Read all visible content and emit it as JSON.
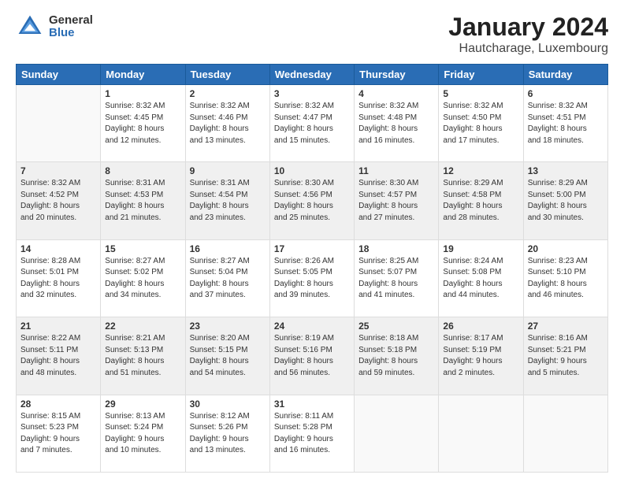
{
  "header": {
    "logo_general": "General",
    "logo_blue": "Blue",
    "title": "January 2024",
    "subtitle": "Hautcharage, Luxembourg"
  },
  "days_of_week": [
    "Sunday",
    "Monday",
    "Tuesday",
    "Wednesday",
    "Thursday",
    "Friday",
    "Saturday"
  ],
  "weeks": [
    [
      {
        "day": "",
        "info": ""
      },
      {
        "day": "1",
        "info": "Sunrise: 8:32 AM\nSunset: 4:45 PM\nDaylight: 8 hours\nand 12 minutes."
      },
      {
        "day": "2",
        "info": "Sunrise: 8:32 AM\nSunset: 4:46 PM\nDaylight: 8 hours\nand 13 minutes."
      },
      {
        "day": "3",
        "info": "Sunrise: 8:32 AM\nSunset: 4:47 PM\nDaylight: 8 hours\nand 15 minutes."
      },
      {
        "day": "4",
        "info": "Sunrise: 8:32 AM\nSunset: 4:48 PM\nDaylight: 8 hours\nand 16 minutes."
      },
      {
        "day": "5",
        "info": "Sunrise: 8:32 AM\nSunset: 4:50 PM\nDaylight: 8 hours\nand 17 minutes."
      },
      {
        "day": "6",
        "info": "Sunrise: 8:32 AM\nSunset: 4:51 PM\nDaylight: 8 hours\nand 18 minutes."
      }
    ],
    [
      {
        "day": "7",
        "info": "Sunrise: 8:32 AM\nSunset: 4:52 PM\nDaylight: 8 hours\nand 20 minutes."
      },
      {
        "day": "8",
        "info": "Sunrise: 8:31 AM\nSunset: 4:53 PM\nDaylight: 8 hours\nand 21 minutes."
      },
      {
        "day": "9",
        "info": "Sunrise: 8:31 AM\nSunset: 4:54 PM\nDaylight: 8 hours\nand 23 minutes."
      },
      {
        "day": "10",
        "info": "Sunrise: 8:30 AM\nSunset: 4:56 PM\nDaylight: 8 hours\nand 25 minutes."
      },
      {
        "day": "11",
        "info": "Sunrise: 8:30 AM\nSunset: 4:57 PM\nDaylight: 8 hours\nand 27 minutes."
      },
      {
        "day": "12",
        "info": "Sunrise: 8:29 AM\nSunset: 4:58 PM\nDaylight: 8 hours\nand 28 minutes."
      },
      {
        "day": "13",
        "info": "Sunrise: 8:29 AM\nSunset: 5:00 PM\nDaylight: 8 hours\nand 30 minutes."
      }
    ],
    [
      {
        "day": "14",
        "info": "Sunrise: 8:28 AM\nSunset: 5:01 PM\nDaylight: 8 hours\nand 32 minutes."
      },
      {
        "day": "15",
        "info": "Sunrise: 8:27 AM\nSunset: 5:02 PM\nDaylight: 8 hours\nand 34 minutes."
      },
      {
        "day": "16",
        "info": "Sunrise: 8:27 AM\nSunset: 5:04 PM\nDaylight: 8 hours\nand 37 minutes."
      },
      {
        "day": "17",
        "info": "Sunrise: 8:26 AM\nSunset: 5:05 PM\nDaylight: 8 hours\nand 39 minutes."
      },
      {
        "day": "18",
        "info": "Sunrise: 8:25 AM\nSunset: 5:07 PM\nDaylight: 8 hours\nand 41 minutes."
      },
      {
        "day": "19",
        "info": "Sunrise: 8:24 AM\nSunset: 5:08 PM\nDaylight: 8 hours\nand 44 minutes."
      },
      {
        "day": "20",
        "info": "Sunrise: 8:23 AM\nSunset: 5:10 PM\nDaylight: 8 hours\nand 46 minutes."
      }
    ],
    [
      {
        "day": "21",
        "info": "Sunrise: 8:22 AM\nSunset: 5:11 PM\nDaylight: 8 hours\nand 48 minutes."
      },
      {
        "day": "22",
        "info": "Sunrise: 8:21 AM\nSunset: 5:13 PM\nDaylight: 8 hours\nand 51 minutes."
      },
      {
        "day": "23",
        "info": "Sunrise: 8:20 AM\nSunset: 5:15 PM\nDaylight: 8 hours\nand 54 minutes."
      },
      {
        "day": "24",
        "info": "Sunrise: 8:19 AM\nSunset: 5:16 PM\nDaylight: 8 hours\nand 56 minutes."
      },
      {
        "day": "25",
        "info": "Sunrise: 8:18 AM\nSunset: 5:18 PM\nDaylight: 8 hours\nand 59 minutes."
      },
      {
        "day": "26",
        "info": "Sunrise: 8:17 AM\nSunset: 5:19 PM\nDaylight: 9 hours\nand 2 minutes."
      },
      {
        "day": "27",
        "info": "Sunrise: 8:16 AM\nSunset: 5:21 PM\nDaylight: 9 hours\nand 5 minutes."
      }
    ],
    [
      {
        "day": "28",
        "info": "Sunrise: 8:15 AM\nSunset: 5:23 PM\nDaylight: 9 hours\nand 7 minutes."
      },
      {
        "day": "29",
        "info": "Sunrise: 8:13 AM\nSunset: 5:24 PM\nDaylight: 9 hours\nand 10 minutes."
      },
      {
        "day": "30",
        "info": "Sunrise: 8:12 AM\nSunset: 5:26 PM\nDaylight: 9 hours\nand 13 minutes."
      },
      {
        "day": "31",
        "info": "Sunrise: 8:11 AM\nSunset: 5:28 PM\nDaylight: 9 hours\nand 16 minutes."
      },
      {
        "day": "",
        "info": ""
      },
      {
        "day": "",
        "info": ""
      },
      {
        "day": "",
        "info": ""
      }
    ]
  ]
}
